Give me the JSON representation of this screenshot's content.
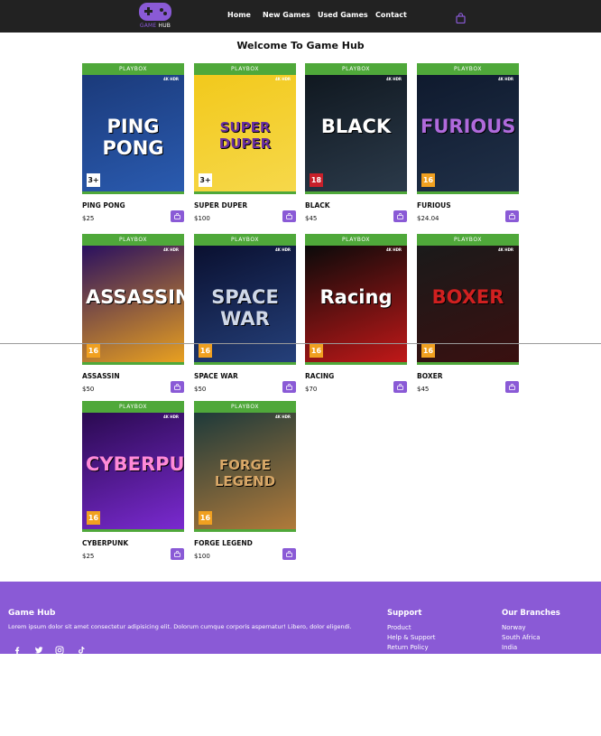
{
  "brand": {
    "logo_primary": "GAME",
    "logo_secondary": "HUB"
  },
  "nav": {
    "links": [
      "Home",
      "New Games",
      "Used Games",
      "Contact"
    ],
    "cart_icon": "shopping-bag-icon"
  },
  "page_title": "Welcome To Game Hub",
  "store_label": "PLAYBOX",
  "badge_text": "4K HDR",
  "products": [
    {
      "name": "PING PONG",
      "price": "$25",
      "art_title": "PING PONG",
      "rating": "3+",
      "colors": [
        "#1b3a7a",
        "#2a5bb0"
      ],
      "title_color": "#ffffff"
    },
    {
      "name": "SUPER DUPER",
      "price": "$100",
      "art_title": "SUPER DUPER",
      "rating": "3+",
      "colors": [
        "#f2c91c",
        "#f6d84a"
      ],
      "title_color": "#6a2fa0"
    },
    {
      "name": "BLACK",
      "price": "$45",
      "art_title": "BLACK",
      "rating": "18",
      "colors": [
        "#101820",
        "#2b3a4a"
      ],
      "title_color": "#ffffff"
    },
    {
      "name": "FURIOUS",
      "price": "$24.04",
      "art_title": "FURIOUS",
      "rating": "16",
      "colors": [
        "#0f1a2e",
        "#203048"
      ],
      "title_color": "#b06adc"
    },
    {
      "name": "ASSASSIN",
      "price": "$50",
      "art_title": "ASSASSIN",
      "rating": "16",
      "colors": [
        "#2a1060",
        "#e8a020"
      ],
      "title_color": "#ffffff"
    },
    {
      "name": "SPACE WAR",
      "price": "$50",
      "art_title": "SPACE WAR",
      "rating": "16",
      "colors": [
        "#0a1030",
        "#25407a"
      ],
      "title_color": "#cfd8e8"
    },
    {
      "name": "RACING",
      "price": "$70",
      "art_title": "Racing",
      "rating": "16",
      "colors": [
        "#0a0a0a",
        "#c01818"
      ],
      "title_color": "#ffffff"
    },
    {
      "name": "BOXER",
      "price": "$45",
      "art_title": "BOXER",
      "rating": "16",
      "colors": [
        "#1a1a1a",
        "#3a1010"
      ],
      "title_color": "#d02020"
    },
    {
      "name": "CYBERPUNK",
      "price": "$25",
      "art_title": "CYBERPUNK",
      "rating": "16",
      "colors": [
        "#2a0a50",
        "#7a2ad0"
      ],
      "title_color": "#ff8ad8"
    },
    {
      "name": "FORGE LEGEND",
      "price": "$100",
      "art_title": "FORGE LEGEND",
      "rating": "16",
      "colors": [
        "#1e3a3a",
        "#b07a3a"
      ],
      "title_color": "#d9a868"
    }
  ],
  "footer": {
    "brand": "Game Hub",
    "description": "Lorem ipsum dolor sit amet consectetur adipisicing elit. Dolorum cumque corporis aspernatur! Libero, dolor eligendi.",
    "social_icons": [
      "facebook-icon",
      "twitter-icon",
      "instagram-icon",
      "tiktok-icon"
    ],
    "support": {
      "title": "Support",
      "items": [
        "Product",
        "Help & Support",
        "Return Policy"
      ]
    },
    "branches": {
      "title": "Our Branches",
      "items": [
        "Norway",
        "South Africa",
        "India"
      ]
    }
  },
  "colors": {
    "accent": "#8a5ad6",
    "nav_bg": "#222222",
    "store_green": "#4fa83a"
  }
}
